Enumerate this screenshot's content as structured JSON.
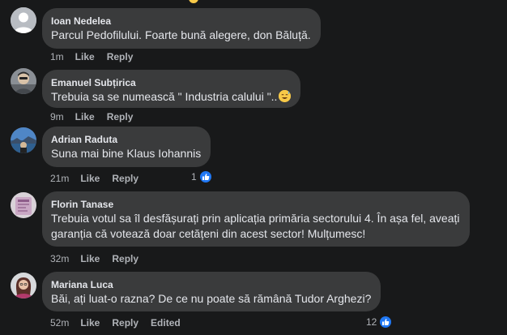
{
  "comments": [
    {
      "author": "Ioan Nedelea",
      "text": "Parcul Pedofilului. Foarte bună alegere, don Băluță.",
      "time": "1m",
      "like": "Like",
      "reply": "Reply",
      "avatar": "default-avatar"
    },
    {
      "author": "Emanuel Subțirica",
      "text": "Trebuia sa se numească \" Industria calului \"..",
      "emoji": "grinning-sweat-emoji",
      "time": "9m",
      "like": "Like",
      "reply": "Reply",
      "avatar": "photo-avatar"
    },
    {
      "author": "Adrian Raduta",
      "text": "Suna mai bine Klaus Iohannis",
      "time": "21m",
      "like": "Like",
      "reply": "Reply",
      "reaction_count": "1",
      "reaction_icon": "like-icon",
      "avatar": "photo-avatar"
    },
    {
      "author": "Florin Tanase",
      "text_lines": [
        "Trebuia votul sa îl desfășurați prin aplicația primăria sectorului 4. În așa fel, aveați",
        "garanția că votează doar cetățeni din acest sector! Mulțumesc!"
      ],
      "time": "32m",
      "like": "Like",
      "reply": "Reply",
      "avatar": "photo-avatar"
    },
    {
      "author": "Mariana Luca",
      "text": "Băi, ați luat-o razna? De ce nu poate să rămână Tudor Arghezi?",
      "time": "52m",
      "like": "Like",
      "reply": "Reply",
      "edited": "Edited",
      "reaction_count": "12",
      "reaction_icon": "like-icon",
      "avatar": "photo-avatar"
    }
  ],
  "colors": {
    "background": "#18191a",
    "bubble": "#3a3b3c",
    "text": "#e4e6eb",
    "secondary": "#b0b3b8",
    "like_blue": "#2078f4"
  }
}
